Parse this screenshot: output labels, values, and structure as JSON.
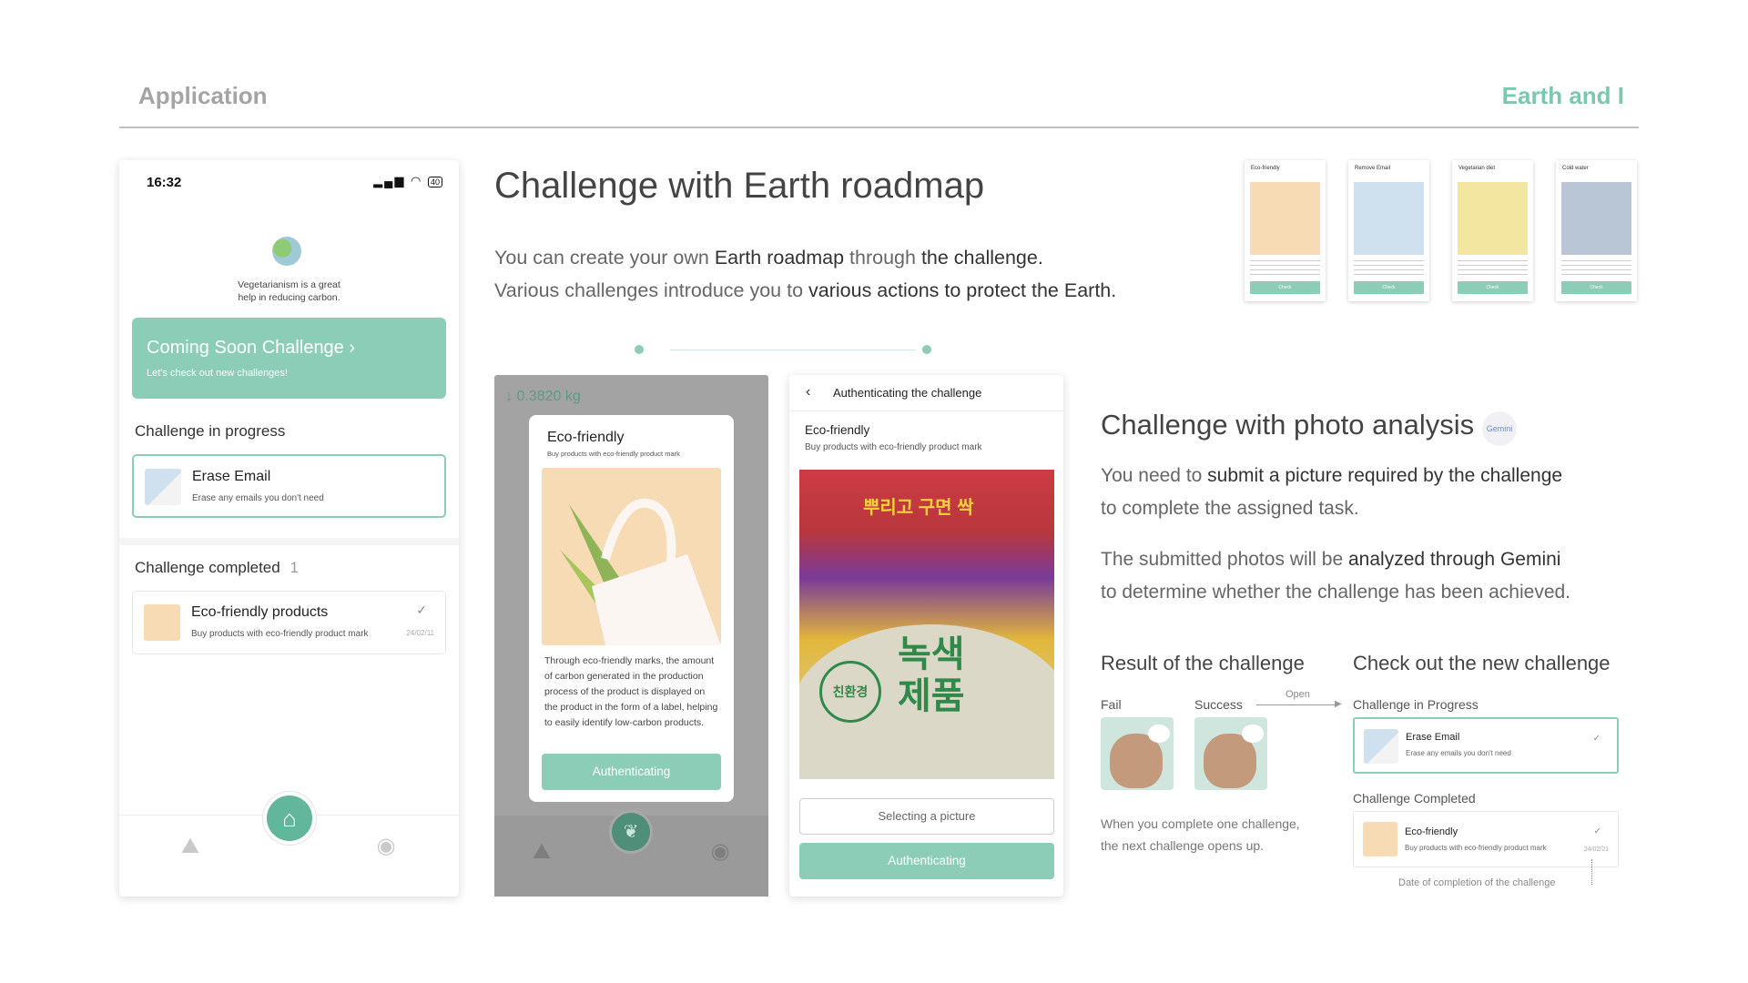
{
  "header": {
    "left": "Application",
    "right": "Earth and I"
  },
  "phone1": {
    "time": "16:32",
    "battery": "40",
    "tip": "Vegetarianism is a great help in reducing carbon.",
    "coming_title": "Coming Soon Challenge",
    "coming_sub": "Let's check out new challenges!",
    "in_progress_label": "Challenge in progress",
    "erase_title": "Erase Email",
    "erase_sub": "Erase any emails you don't need",
    "completed_label": "Challenge completed",
    "completed_count": "1",
    "eco_title": "Eco-friendly products",
    "eco_sub": "Buy products with eco-friendly product mark",
    "eco_date": "24/02/11"
  },
  "section1": {
    "title": "Challenge with Earth roadmap",
    "line1_a": "You can create your own ",
    "line1_b": "Earth roadmap",
    "line1_c": " through ",
    "line1_d": "the challenge.",
    "line2_a": "Various challenges introduce you to ",
    "line2_b": "various actions to protect the Earth."
  },
  "mini_cards": [
    {
      "title": "Eco-friendly",
      "btn": "Check",
      "color": "#f6dbb5"
    },
    {
      "title": "Remove Email",
      "btn": "Check",
      "color": "#cfe0ee"
    },
    {
      "title": "Vegetarian diet",
      "btn": "Check",
      "color": "#f3e6a0"
    },
    {
      "title": "Cold water",
      "btn": "Check",
      "color": "#b8c6d6"
    }
  ],
  "phone2": {
    "kg": "↓ 0.3820 kg",
    "modal_title": "Eco-friendly",
    "modal_sub": "Buy products with eco-friendly product mark",
    "modal_text": "Through eco-friendly marks, the amount of carbon generated in the production process of the product is displayed on the product in the form of a label, helping to easily identify low-carbon products.",
    "modal_btn": "Authenticating"
  },
  "phone3": {
    "header": "Authenticating the challenge",
    "title": "Eco-friendly",
    "sub": "Buy products with eco-friendly product mark",
    "photo_big": "녹색 제품",
    "photo_circle": "친환경",
    "photo_top": "뿌리고 구면 싹",
    "select_btn": "Selecting a picture",
    "auth_btn": "Authenticating"
  },
  "section2": {
    "title": "Challenge with photo analysis",
    "gemini": "Gemini",
    "p1_a": "You need to ",
    "p1_b": "submit a picture required by the challenge",
    "p1_c": "to complete the assigned task.",
    "p2_a": "The submitted photos will be ",
    "p2_b": "analyzed through Gemini",
    "p2_c": "to determine whether the challenge has been achieved."
  },
  "result": {
    "title": "Result of the challenge",
    "fail": "Fail",
    "success": "Success",
    "open": "Open",
    "note1": "When you complete one challenge,",
    "note2": "the next challenge opens up."
  },
  "new_challenge": {
    "title": "Check out the new challenge",
    "in_progress": "Challenge in Progress",
    "erase_title": "Erase Email",
    "erase_sub": "Erase any emails you don't need",
    "completed": "Challenge Completed",
    "eco_title": "Eco-friendly",
    "eco_sub": "Buy products with eco-friendly product mark",
    "eco_date": "24/02/21",
    "date_note": "Date of completion of the challenge"
  }
}
